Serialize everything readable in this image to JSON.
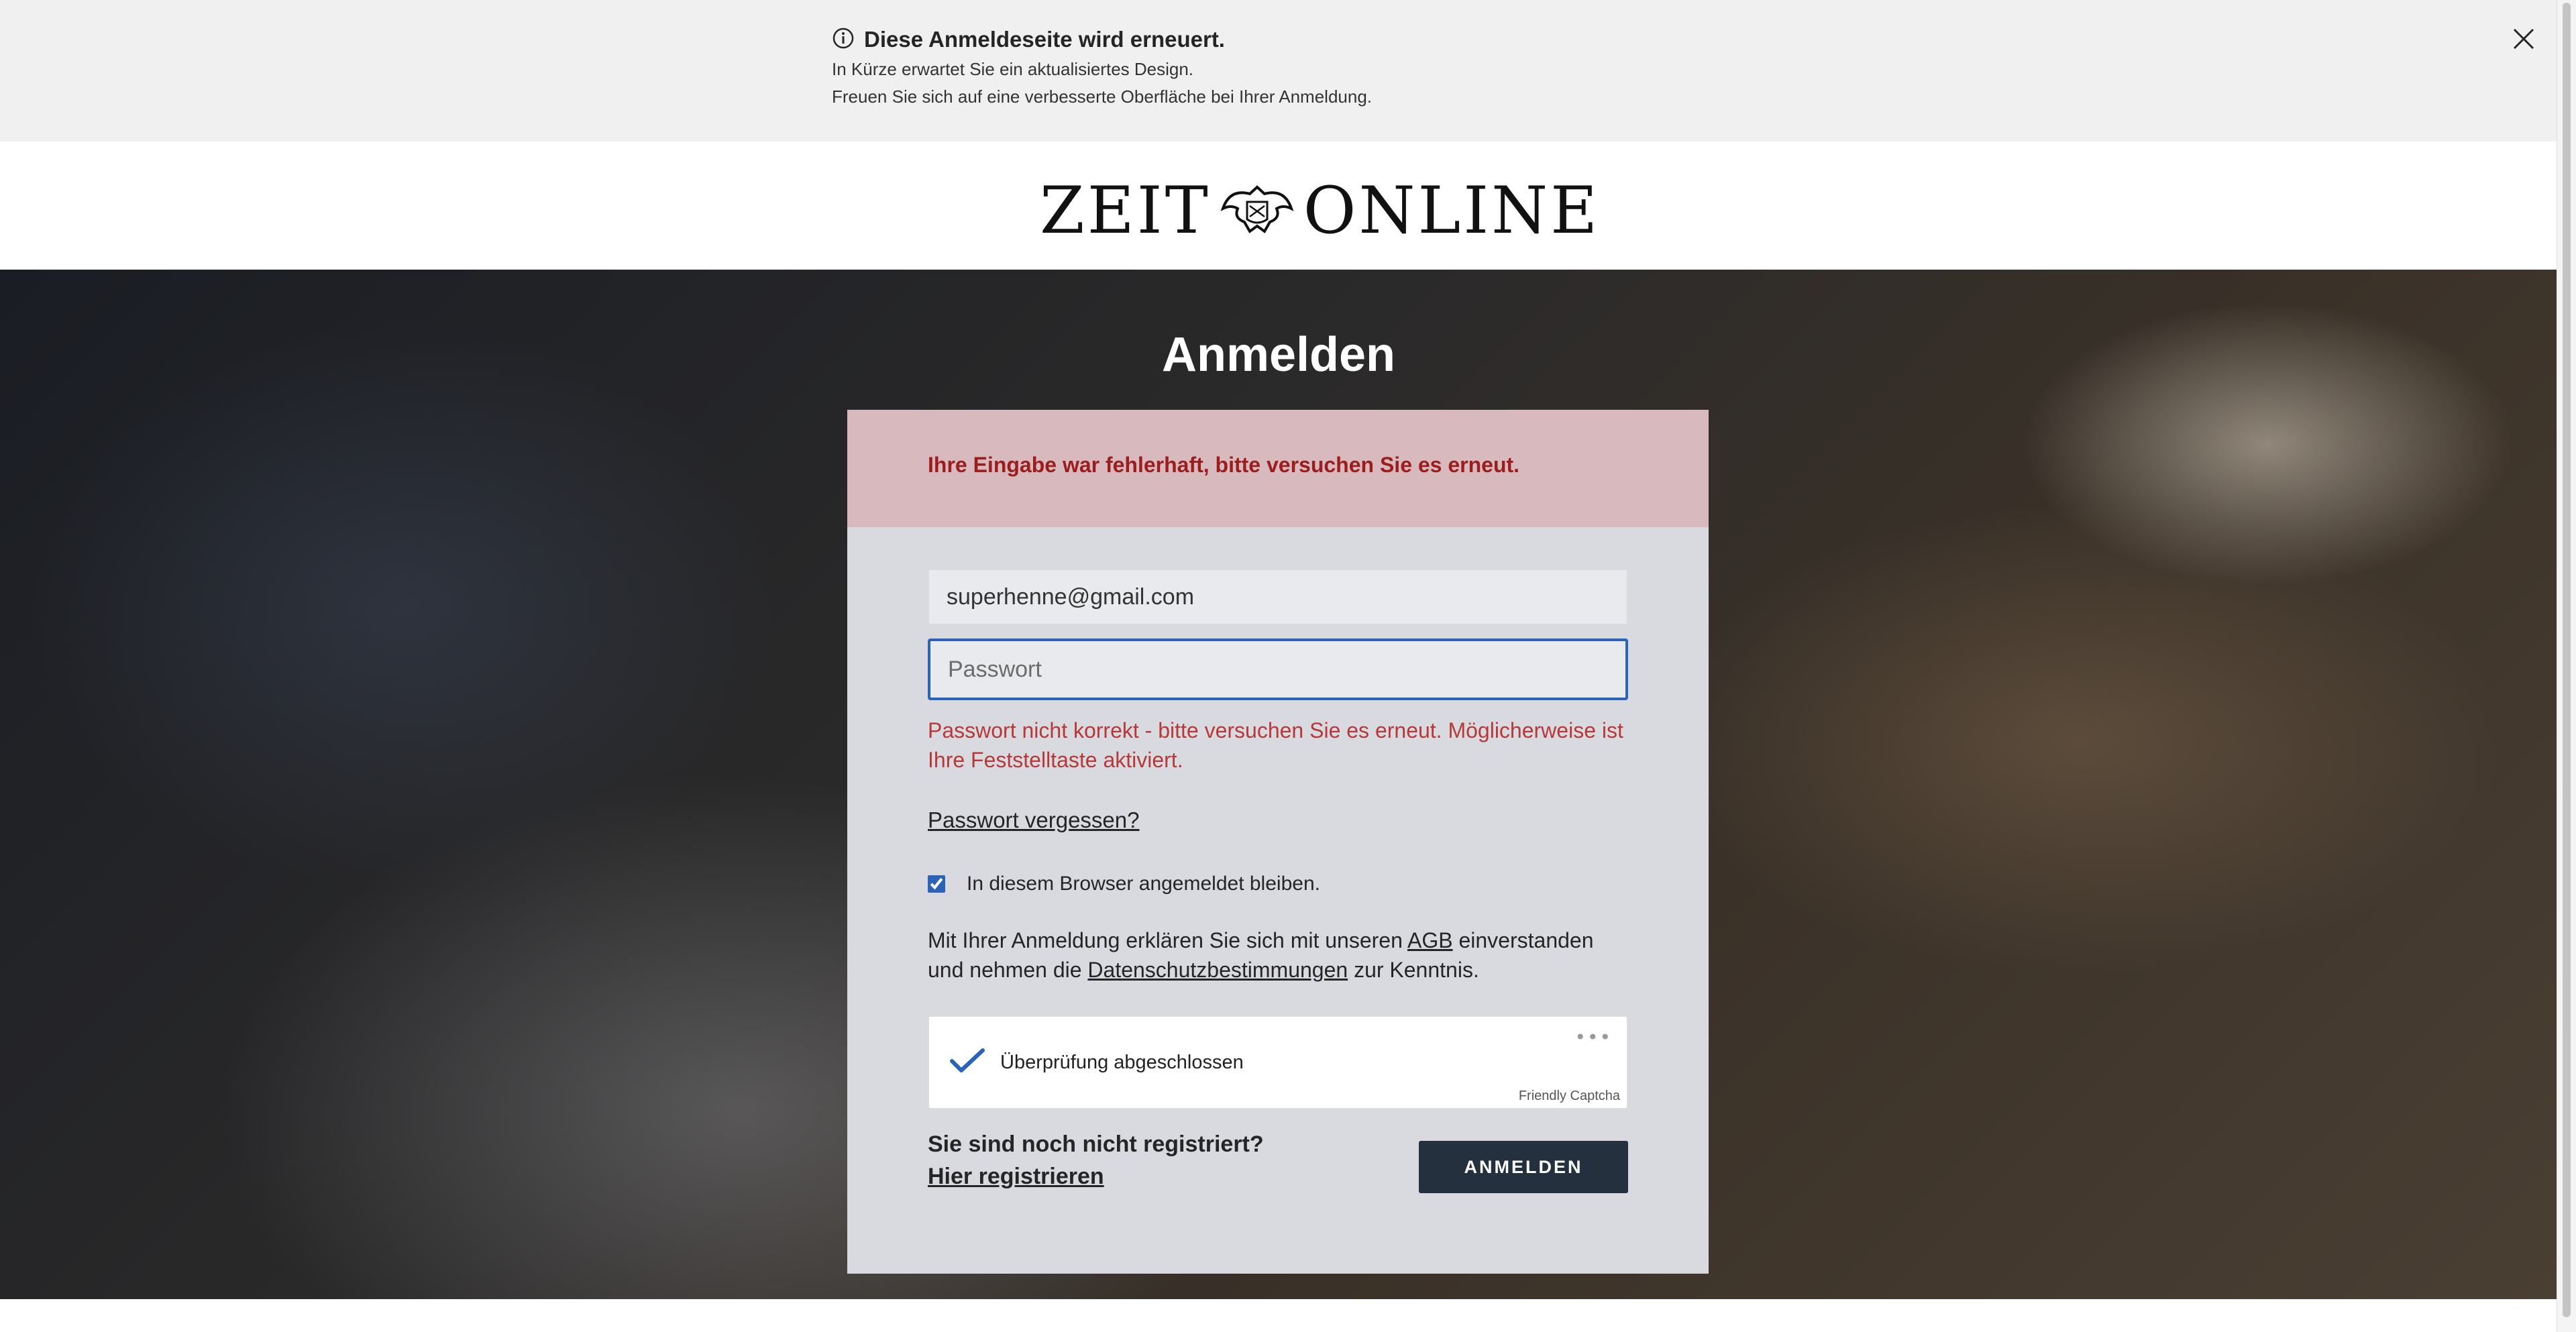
{
  "notice": {
    "title": "Diese Anmeldeseite wird erneuert.",
    "line1": "In Kürze erwartet Sie ein aktualisiertes Design.",
    "line2": "Freuen Sie sich auf eine verbesserte Oberfläche bei Ihrer Anmeldung.",
    "info_icon": "info-icon",
    "close_icon": "close-icon"
  },
  "header": {
    "logo_left": "ZEIT",
    "logo_right": "ONLINE",
    "logo_emblem": "eagle-emblem-icon"
  },
  "page": {
    "title": "Anmelden"
  },
  "form": {
    "alert": "Ihre Eingabe war fehlerhaft, bitte versuchen Sie es erneut.",
    "email_value": "superhenne@gmail.com",
    "password_placeholder": "Passwort",
    "password_error": "Passwort nicht korrekt - bitte versuchen Sie es erneut. Möglicherweise ist Ihre Feststelltaste aktiviert.",
    "forgot_link": "Passwort vergessen?",
    "remember_label": "In diesem Browser angemeldet bleiben.",
    "remember_checked": true,
    "terms_part1": "Mit Ihrer Anmeldung erklären Sie sich mit unseren ",
    "terms_agb": "AGB",
    "terms_part2": " einverstanden und nehmen die ",
    "terms_privacy": "Datenschutzbestimmungen",
    "terms_part3": " zur Kenntnis.",
    "captcha_status": "Überprüfung abgeschlossen",
    "captcha_brand": "Friendly Captcha",
    "captcha_menu": "•••",
    "register_question": "Sie sind noch nicht registriert?",
    "register_link": "Hier registrieren",
    "submit_label": "ANMELDEN"
  },
  "colors": {
    "alert_bg": "#d8b9be",
    "error_text": "#b73838",
    "button_bg": "#24303e",
    "focus_border": "#2a63b8",
    "captcha_check": "#2a63b8"
  }
}
